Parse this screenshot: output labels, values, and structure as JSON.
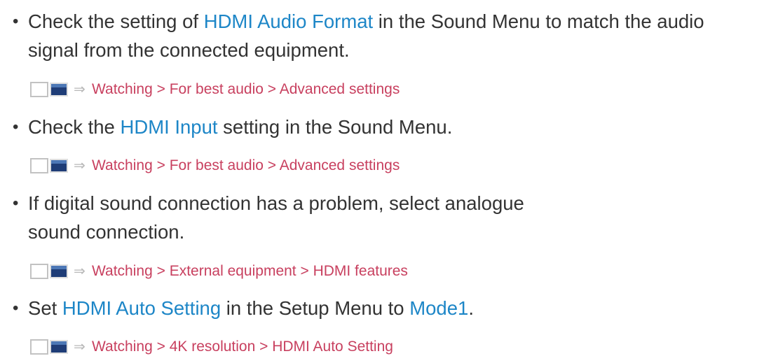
{
  "items": [
    {
      "parts": [
        "Check the setting of ",
        "HDMI Audio Format",
        " in the Sound Menu to match the audio signal from the connected equipment."
      ],
      "reference": "Watching > For best audio > Advanced settings"
    },
    {
      "parts": [
        "Check the ",
        "HDMI Input",
        " setting in the Sound Menu."
      ],
      "reference": "Watching > For best audio > Advanced settings"
    },
    {
      "text": "If digital sound connection has a problem, select analogue sound connection.",
      "reference": "Watching > External equipment > HDMI features"
    },
    {
      "parts": [
        "Set ",
        "HDMI Auto Setting",
        " in the Setup Menu to ",
        "Mode1",
        "."
      ],
      "reference": "Watching > 4K resolution > HDMI Auto Setting"
    }
  ],
  "colors": {
    "highlight": "#1d86c7",
    "reference": "#c8405f",
    "body_text": "#333333"
  },
  "icons": {
    "reference_book": "ebook-icon",
    "reference_arrow": "arrow-right-icon"
  }
}
